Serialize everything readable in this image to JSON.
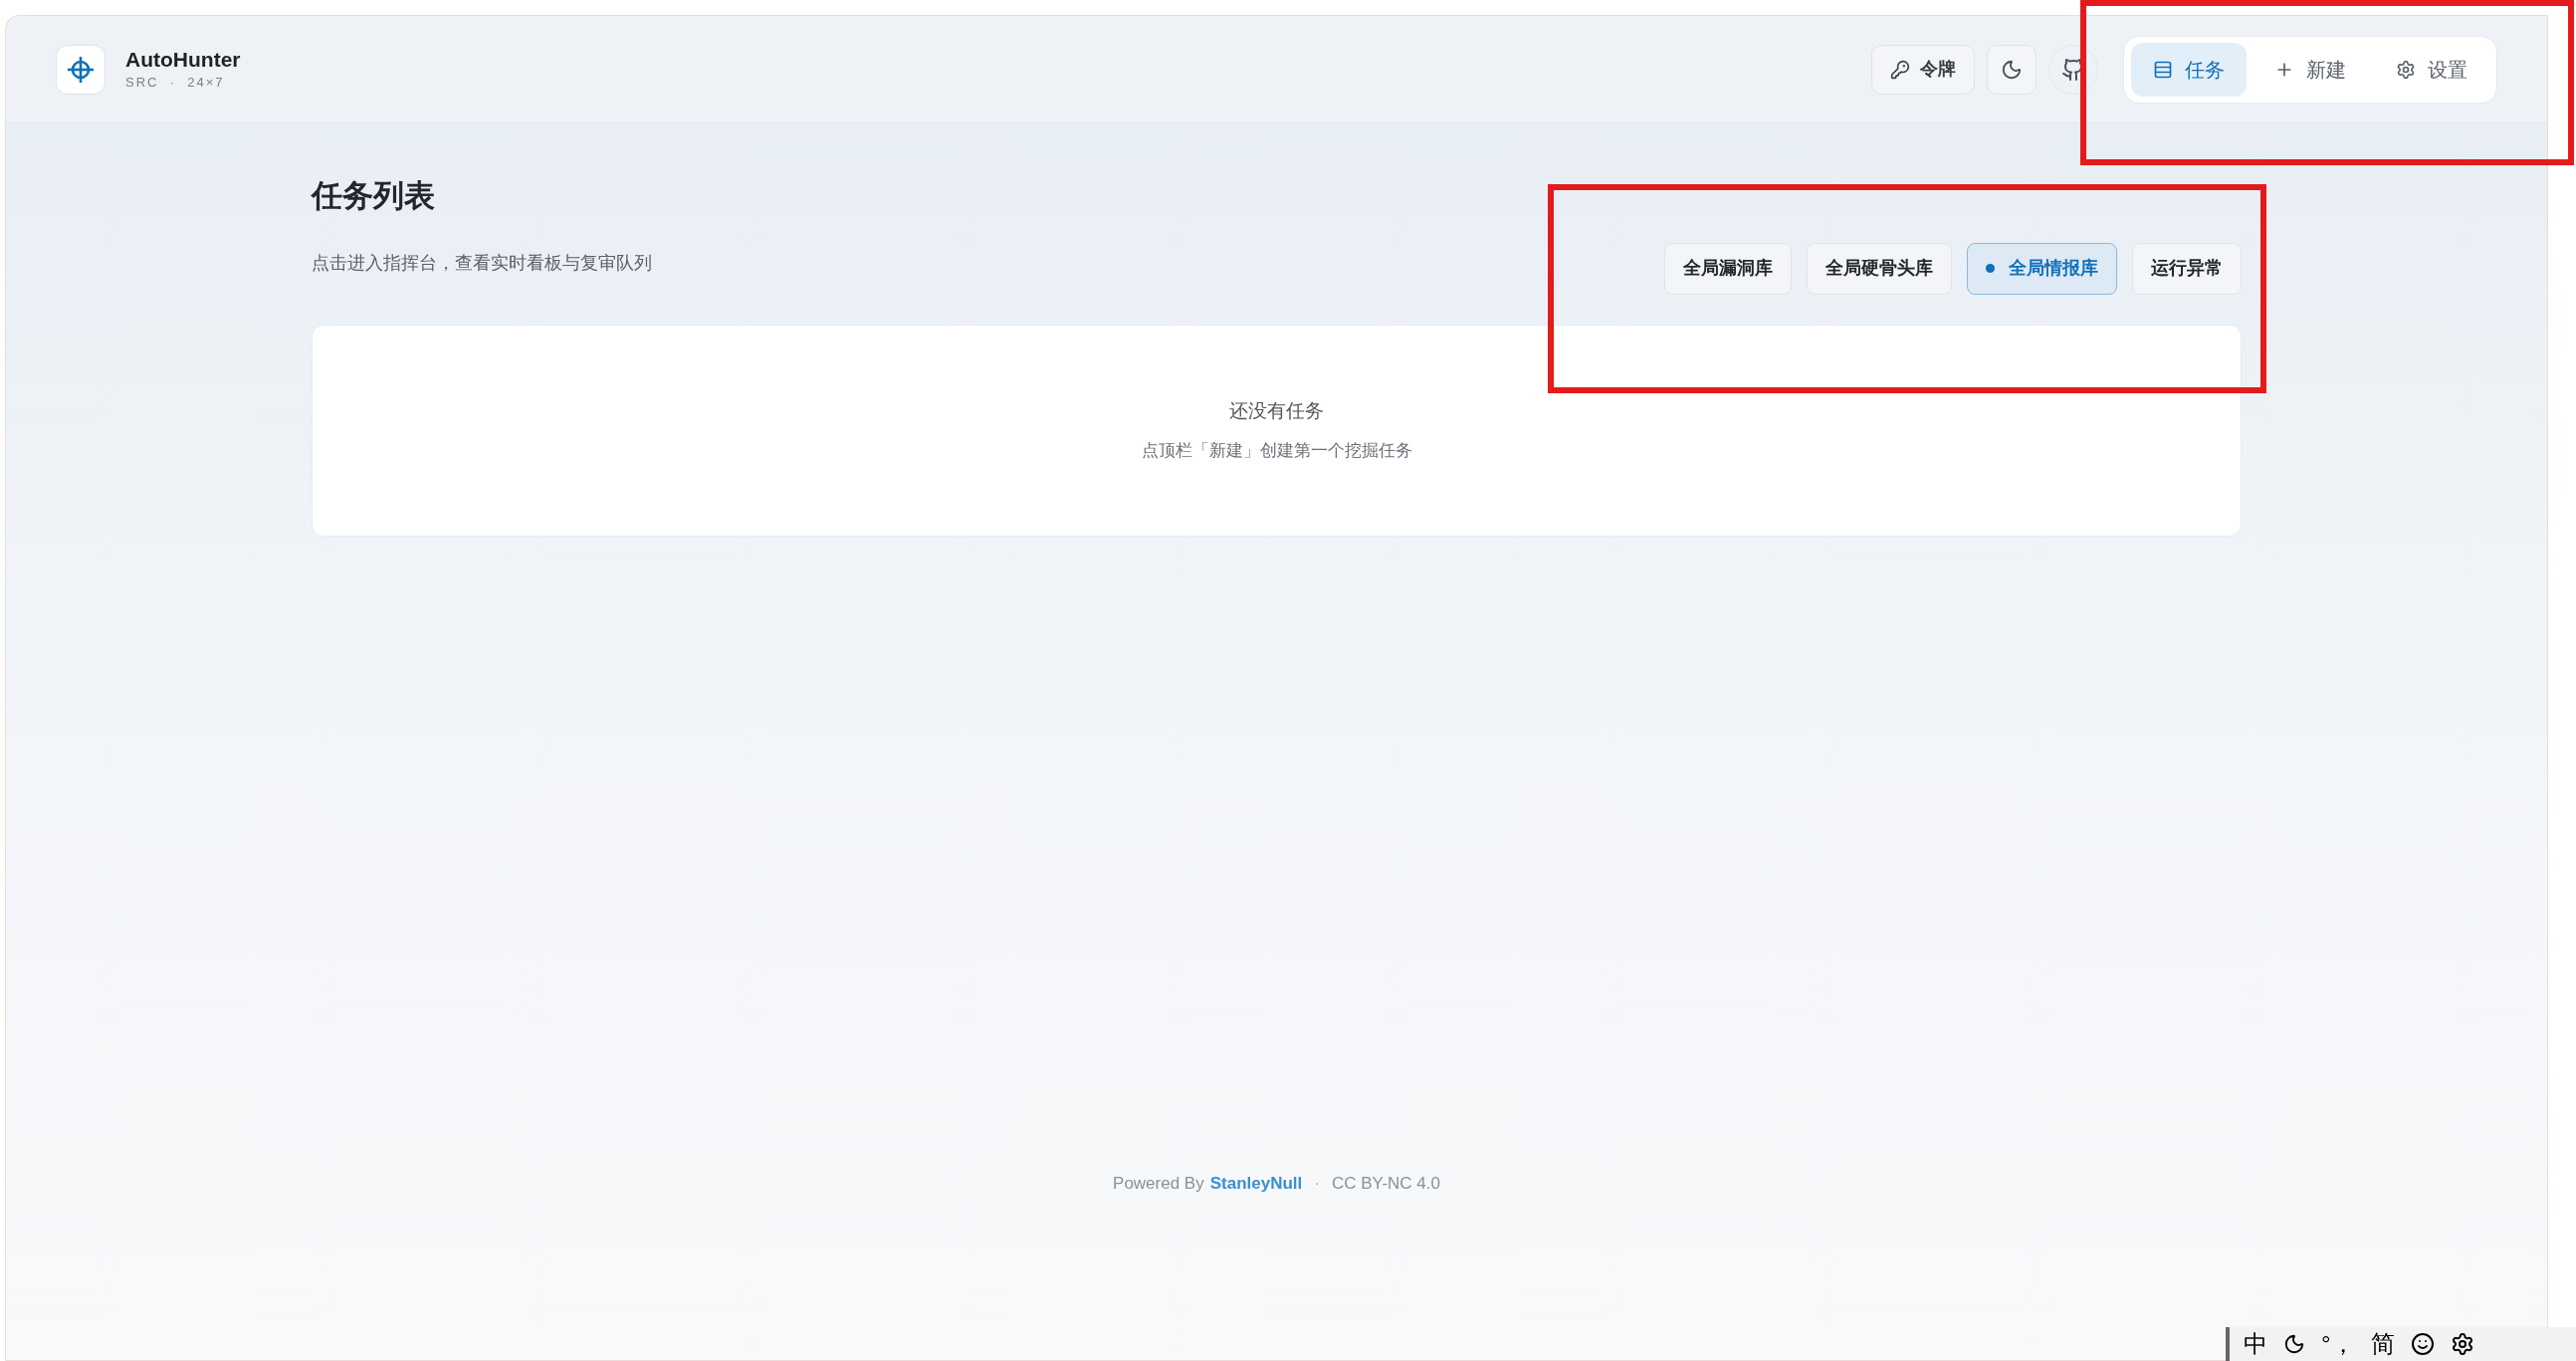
{
  "brand": {
    "name": "AutoHunter",
    "tagline": "SRC  ·  24×7"
  },
  "header_actions": {
    "token_button": "令牌"
  },
  "nav_tabs": [
    {
      "label": "任务",
      "selected": true
    },
    {
      "label": "新建",
      "selected": false
    },
    {
      "label": "设置",
      "selected": false
    }
  ],
  "page": {
    "title": "任务列表",
    "subtitle": "点击进入指挥台，查看实时看板与复审队列"
  },
  "filters": [
    {
      "label": "全局漏洞库",
      "selected": false
    },
    {
      "label": "全局硬骨头库",
      "selected": false
    },
    {
      "label": "全局情报库",
      "selected": true
    },
    {
      "label": "运行异常",
      "selected": false
    }
  ],
  "empty_state": {
    "title": "还没有任务",
    "hint": "点顶栏「新建」创建第一个挖掘任务"
  },
  "footer": {
    "prefix": "Powered By",
    "link": "StanleyNull",
    "separator": "·",
    "license": "CC BY-NC 4.0"
  },
  "ime_toolbar": {
    "mode": "中",
    "punctuation": "°，",
    "script": "简"
  }
}
